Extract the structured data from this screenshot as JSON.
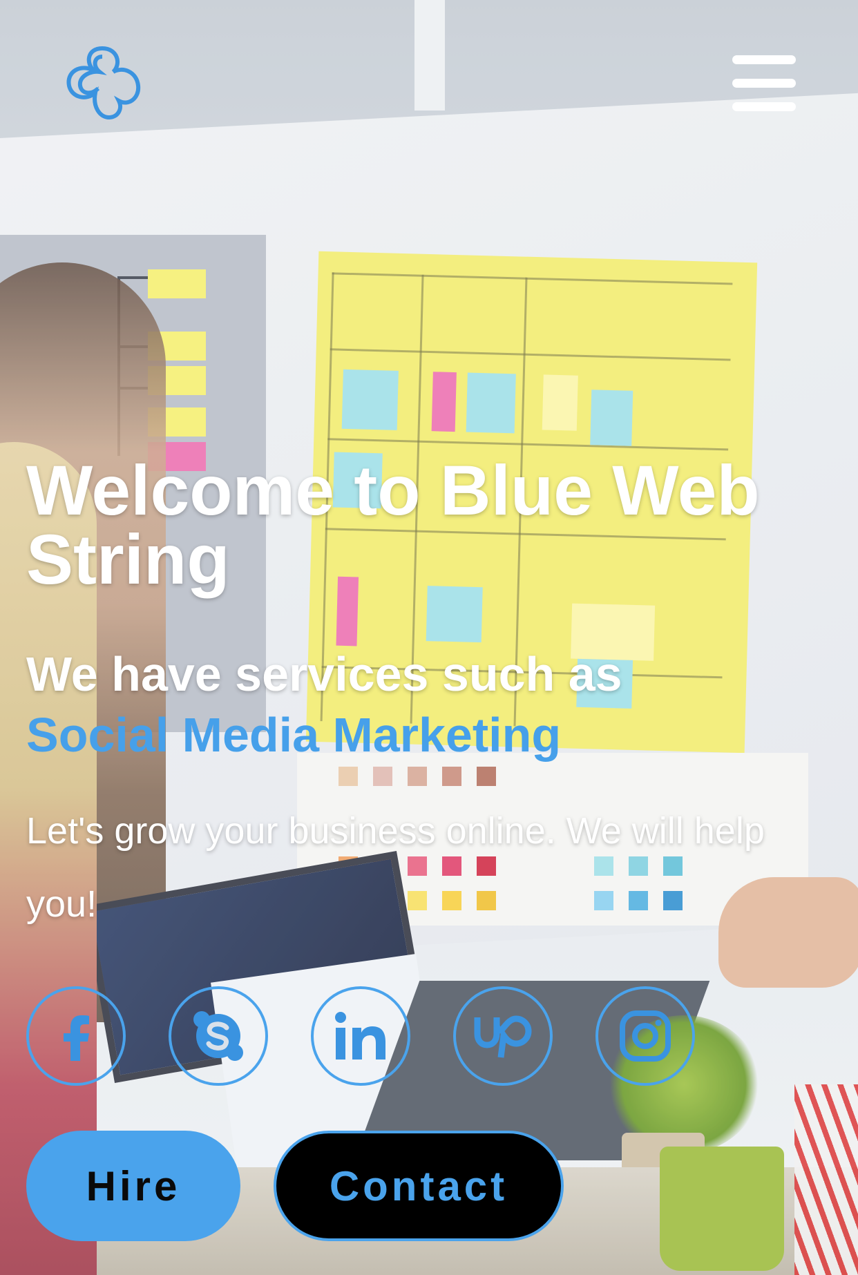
{
  "header": {
    "logo_icon": "trefoil-logo-icon",
    "menu_icon": "hamburger-menu-icon"
  },
  "hero": {
    "title": "Welcome to Blue Web String",
    "services_prefix": "We have services such as",
    "service_highlight": "Social Media Marketing",
    "description": "Let's grow your business online. We will help you!"
  },
  "social": [
    {
      "icon": "facebook-icon"
    },
    {
      "icon": "skype-icon"
    },
    {
      "icon": "linkedin-icon"
    },
    {
      "icon": "upwork-icon"
    },
    {
      "icon": "instagram-icon"
    }
  ],
  "actions": {
    "hire_label": "Hire",
    "contact_label": "Contact"
  },
  "colors": {
    "accent": "#4aa3ec",
    "text": "#ffffff",
    "contact_bg": "#000000"
  }
}
